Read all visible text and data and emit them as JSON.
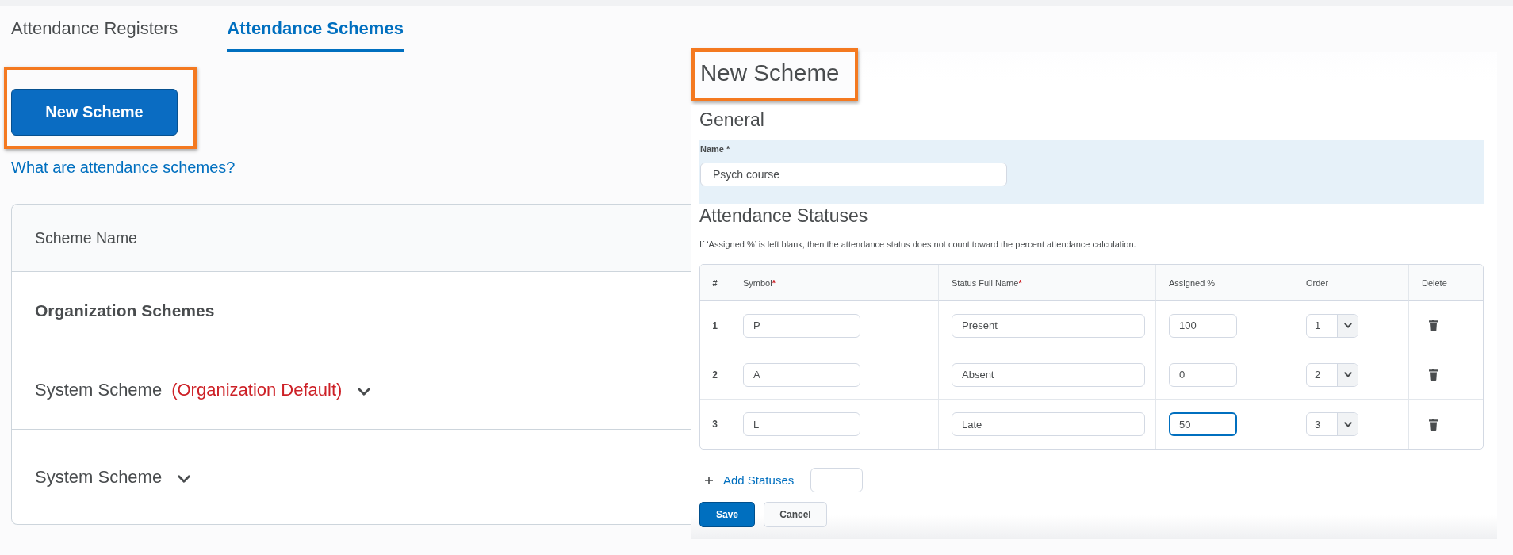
{
  "tabs": [
    {
      "label": "Attendance Registers",
      "selected": false
    },
    {
      "label": "Attendance Schemes",
      "selected": true
    }
  ],
  "new_scheme_button": {
    "label": "New Scheme",
    "highlighted": true
  },
  "help_link": {
    "label": "What are attendance schemes?"
  },
  "schemes_list": {
    "header": "Scheme Name",
    "rows": [
      {
        "kind": "group",
        "name": "Organization Schemes",
        "expandable": false
      },
      {
        "kind": "scheme",
        "name": "System Scheme",
        "note": "(Organization Default)",
        "expandable": true
      },
      {
        "kind": "scheme",
        "name": "System Scheme",
        "expandable": true
      }
    ]
  },
  "new_scheme_panel": {
    "title": "New Scheme",
    "title_highlighted": true,
    "general": {
      "heading": "General",
      "name_field": {
        "label": "Name *",
        "value": "Psych course"
      }
    },
    "statuses": {
      "heading": "Attendance Statuses",
      "note": "If ‘Assigned %’ is left blank, then the attendance status does not count toward the percent attendance calculation.",
      "columns": [
        {
          "label": "#"
        },
        {
          "label": "Symbol",
          "required_mark": "*"
        },
        {
          "label": "Status Full Name",
          "required_mark": "*"
        },
        {
          "label": "Assigned %"
        },
        {
          "label": "Order"
        },
        {
          "label": "Delete"
        }
      ],
      "rows": [
        {
          "number": "1",
          "symbol": "P",
          "full_name": "Present",
          "assigned": "100",
          "order": "1",
          "assigned_focused": false
        },
        {
          "number": "2",
          "symbol": "A",
          "full_name": "Absent",
          "assigned": "0",
          "order": "2",
          "assigned_focused": false
        },
        {
          "number": "3",
          "symbol": "L",
          "full_name": "Late",
          "assigned": "50",
          "order": "3",
          "assigned_focused": true
        }
      ]
    },
    "add_statuses": {
      "label": "Add Statuses"
    },
    "buttons": [
      {
        "label": "Save",
        "kind": "primary"
      },
      {
        "label": "Cancel",
        "kind": "secondary"
      }
    ]
  }
}
